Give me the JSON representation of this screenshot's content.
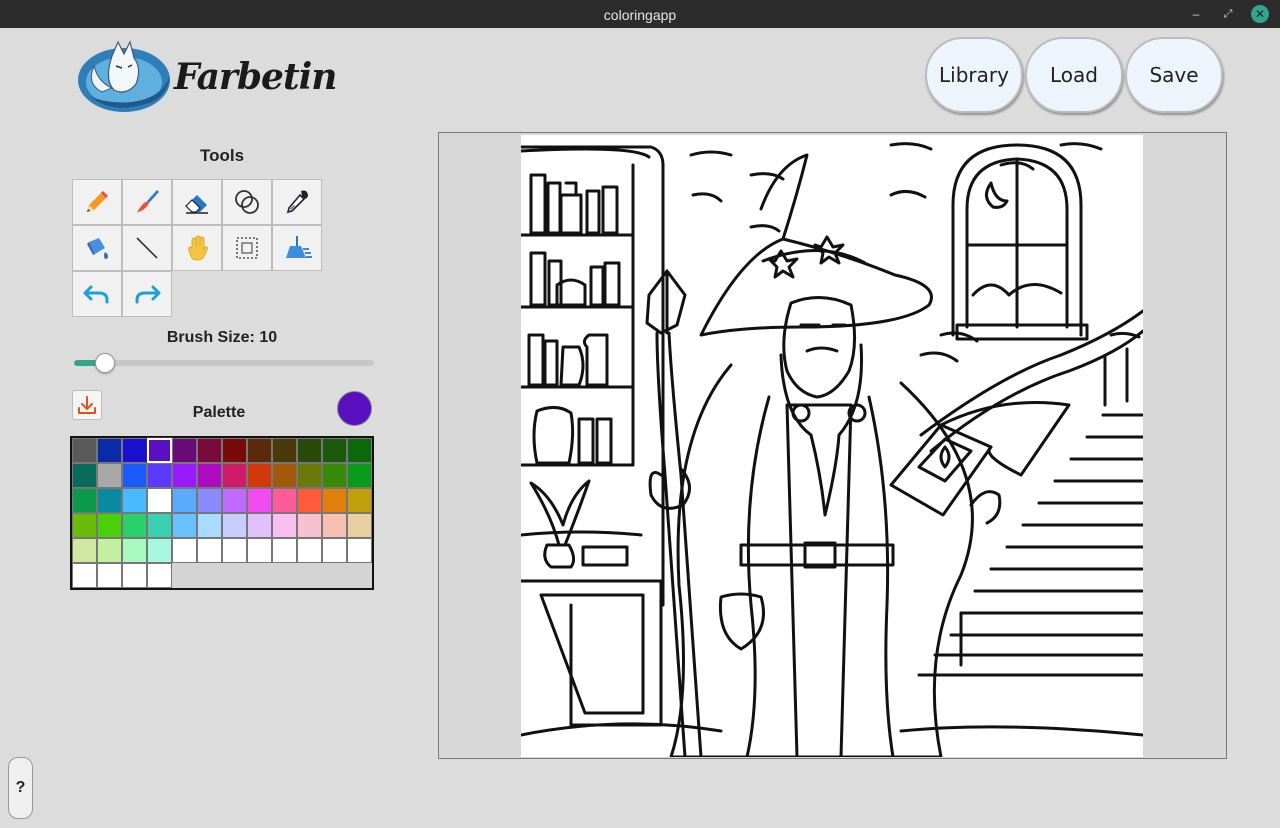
{
  "window": {
    "title": "coloringapp",
    "minimize": "–",
    "maximize": "⤢",
    "close": "✕"
  },
  "logo": {
    "text": "Farbetin"
  },
  "header": {
    "library_label": "Library",
    "load_label": "Load",
    "save_label": "Save"
  },
  "tools": {
    "title": "Tools",
    "items": [
      {
        "name": "pencil",
        "icon": "pencil-icon"
      },
      {
        "name": "brush",
        "icon": "brush-icon"
      },
      {
        "name": "eraser",
        "icon": "eraser-icon"
      },
      {
        "name": "blend",
        "icon": "blend-rings-icon"
      },
      {
        "name": "eyedropper",
        "icon": "eyedropper-icon"
      },
      {
        "name": "fill",
        "icon": "paint-bucket-icon"
      },
      {
        "name": "line",
        "icon": "line-icon"
      },
      {
        "name": "pan",
        "icon": "hand-icon"
      },
      {
        "name": "select",
        "icon": "selection-icon"
      },
      {
        "name": "clear",
        "icon": "broom-icon"
      },
      {
        "name": "undo",
        "icon": "undo-icon"
      },
      {
        "name": "redo",
        "icon": "redo-icon"
      }
    ]
  },
  "brush": {
    "label": "Brush Size: 10",
    "value": 10,
    "min": 1,
    "max": 120
  },
  "palette": {
    "label": "Palette",
    "current_color": "#5a0fc0",
    "selected_index": 3,
    "colors": [
      "#5a5a5a",
      "#0a2aa8",
      "#1a0fd0",
      "#5a0fc0",
      "#6a0a78",
      "#7a0a3a",
      "#7a0a0a",
      "#5a2a0a",
      "#4a3a0a",
      "#2a4a0a",
      "#1a5a0a",
      "#0a6a0a",
      "#0a6a5a",
      "#a8a8a8",
      "#1a5aff",
      "#5a3aff",
      "#9a1aff",
      "#b00ac0",
      "#d01a6a",
      "#d03a0a",
      "#a05a0a",
      "#6a7a0a",
      "#3a8a0a",
      "#0a9a1a",
      "#0a9a4a",
      "#0a8aa0",
      "#4abaff",
      "#ffffff",
      "#5aaaff",
      "#8a8aff",
      "#c06aff",
      "#f04af0",
      "#ff5a9a",
      "#ff5a3a",
      "#e0800a",
      "#c0a00a",
      "#6aba0a",
      "#4ad00a",
      "#2ad06a",
      "#3ad0b0",
      "#6ac0ff",
      "#a8dcff",
      "#c8ccff",
      "#e0c0ff",
      "#f8c0f0",
      "#f8c0d0",
      "#f8c0b0",
      "#e8d0a0",
      "#d0e8a0",
      "#c0f0a0",
      "#a8f8c0",
      "#a8f8e0",
      "#ffffff",
      "#ffffff",
      "#ffffff",
      "#ffffff",
      "#ffffff",
      "#ffffff",
      "#ffffff",
      "#ffffff",
      "#ffffff",
      "#ffffff",
      "#ffffff",
      "#ffffff"
    ]
  },
  "help": {
    "label": "?"
  },
  "canvas": {
    "description_icon": "wizard-coloring-page"
  }
}
